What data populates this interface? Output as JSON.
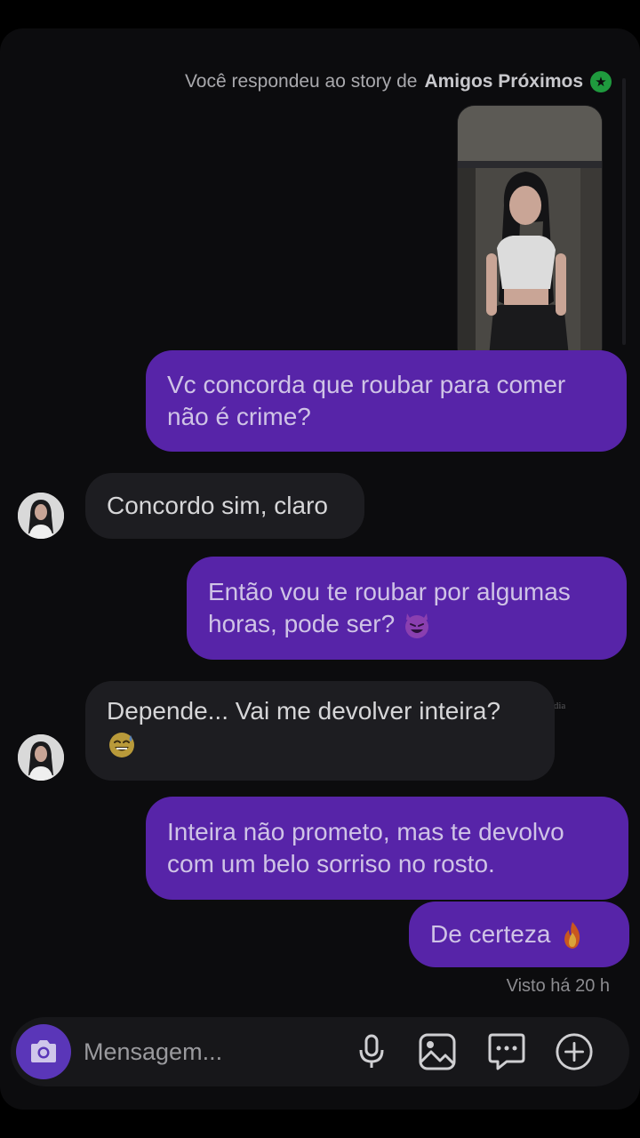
{
  "story": {
    "prefix": "Você respondeu ao story de",
    "list_name": "Amigos Próximos",
    "badge_glyph": "★"
  },
  "messages": [
    {
      "side": "sent",
      "text": "Vc concorda que roubar para comer não é crime?"
    },
    {
      "side": "received",
      "text": "Concordo sim, claro"
    },
    {
      "side": "sent",
      "text": "Então vou te roubar por algumas horas, pode ser?",
      "emoji": "smiling-devil-icon"
    },
    {
      "side": "received",
      "text": "Depende... Vai me devolver inteira?",
      "emoji": "sweat-smile-icon"
    },
    {
      "side": "sent",
      "text": "Inteira não prometo, mas te devolvo com um belo sorriso no rosto."
    },
    {
      "side": "sent",
      "text": "De certeza",
      "emoji": "fire-icon"
    }
  ],
  "watermark": "@caian_damidia",
  "seen_status": "Visto há 20 h",
  "composer": {
    "placeholder": "Mensagem...",
    "icons": [
      "camera-icon",
      "microphone-icon",
      "gallery-icon",
      "sticker-icon",
      "plus-icon"
    ]
  },
  "colors": {
    "sent_bubble": "#5724a8",
    "received_bubble": "#1d1d21",
    "camera_button": "#5a36b8",
    "close_friends_badge": "#1f9a3e",
    "background": "#0c0c0e"
  }
}
